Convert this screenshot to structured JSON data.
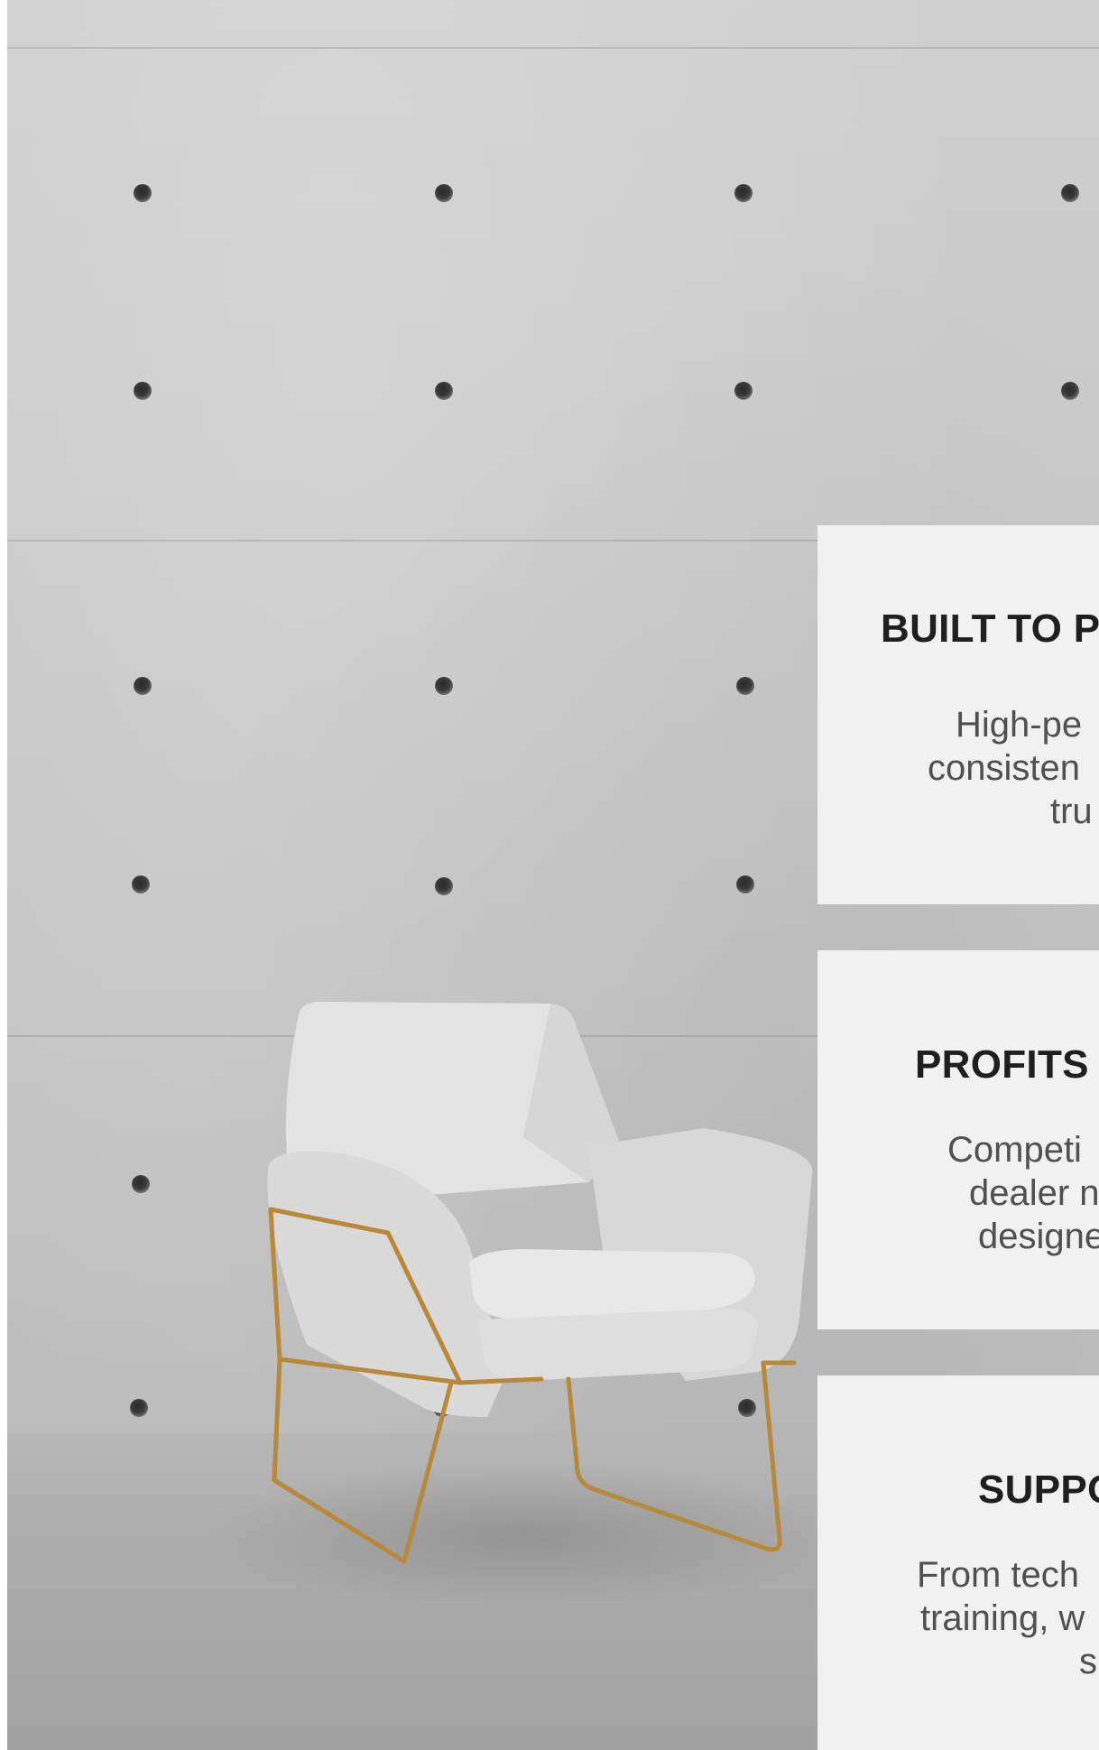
{
  "cards": [
    {
      "title": "BUILT TO P",
      "lines": [
        "High-pe",
        "consisten",
        "tru"
      ]
    },
    {
      "title": "PROFITS",
      "lines": [
        "Competi",
        "dealer n",
        "designe"
      ]
    },
    {
      "title": "SUPPO",
      "lines": [
        "From tech",
        "training, w",
        "s"
      ]
    }
  ],
  "colors": {
    "card_background": "#f1f1f1",
    "title_text": "#1f1f1f",
    "body_text": "#505050",
    "chair_frame": "#b8893a"
  }
}
